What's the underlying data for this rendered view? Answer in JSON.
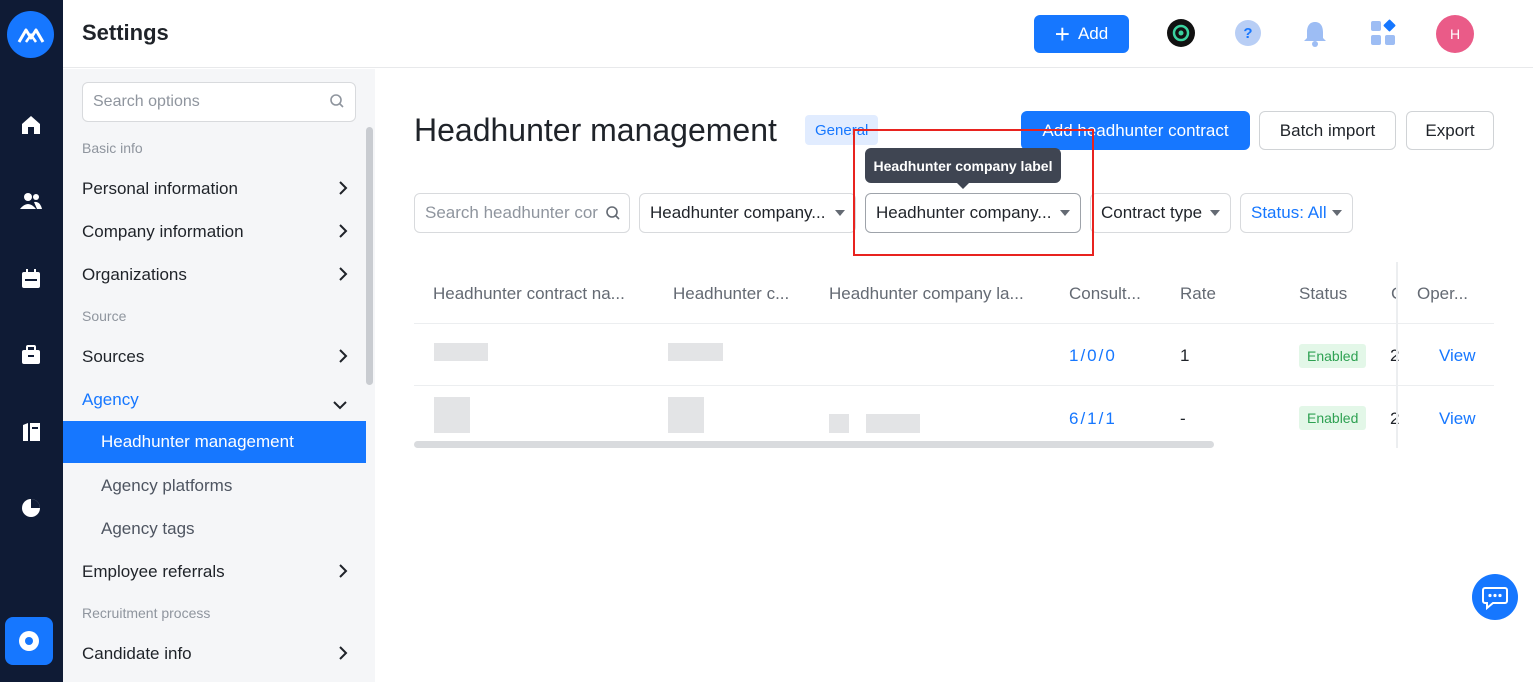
{
  "header": {
    "title": "Settings",
    "add_label": "Add",
    "avatar_initial": "H"
  },
  "sidebar": {
    "search_placeholder": "Search options",
    "sections": {
      "basic_info": "Basic info",
      "source": "Source",
      "recruitment_process": "Recruitment process"
    },
    "items": [
      {
        "label": "Personal information"
      },
      {
        "label": "Company information"
      },
      {
        "label": "Organizations"
      },
      {
        "label": "Sources"
      },
      {
        "label": "Agency"
      },
      {
        "label": "Headhunter management"
      },
      {
        "label": "Agency platforms"
      },
      {
        "label": "Agency tags"
      },
      {
        "label": "Employee referrals"
      },
      {
        "label": "Candidate info"
      }
    ]
  },
  "main": {
    "title": "Headhunter management",
    "badge": "General",
    "add_contract_label": "Add headhunter contract",
    "batch_import_label": "Batch import",
    "export_label": "Export",
    "tooltip": "Headhunter company label",
    "filters": {
      "search_placeholder": "Search headhunter cor",
      "company": "Headhunter company...",
      "company_label": "Headhunter company...",
      "contract_type": "Contract type",
      "status": "Status: All"
    },
    "table": {
      "headers": [
        "Headhunter contract na...",
        "Headhunter c...",
        "Headhunter company la...",
        "Consult...",
        "Rate",
        "Status",
        "C",
        "Oper..."
      ],
      "rows": [
        {
          "consult": "1/0/0",
          "rate": "1",
          "status": "Enabled",
          "c": "2",
          "op": "View"
        },
        {
          "consult": "6/1/1",
          "rate": "-",
          "status": "Enabled",
          "c": "2",
          "op": "View"
        }
      ]
    }
  },
  "colors": {
    "primary": "#1677ff",
    "rail": "#0f1b35",
    "highlight": "#e8231f",
    "enabled": "#2ea152"
  },
  "icons": [
    "logo-icon",
    "home-icon",
    "people-icon",
    "calendar-icon",
    "briefcase-icon",
    "book-icon",
    "pie-chart-icon",
    "settings-icon",
    "search-icon",
    "chevron-right-icon",
    "chevron-down-icon",
    "help-icon",
    "bell-icon",
    "apps-icon",
    "chat-icon"
  ]
}
